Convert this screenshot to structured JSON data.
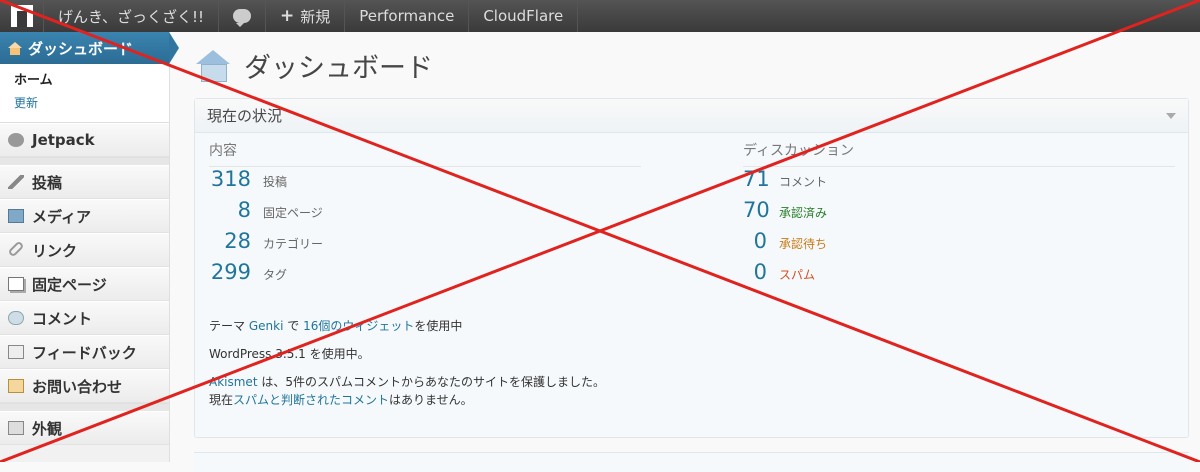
{
  "adminbar": {
    "site_name": "げんき、ざっくざく!!",
    "new_label": "新規",
    "performance": "Performance",
    "cloudflare": "CloudFlare"
  },
  "sidebar": {
    "dashboard": "ダッシュボード",
    "submenu_home": "ホーム",
    "submenu_updates": "更新",
    "items": [
      {
        "label": "Jetpack",
        "icon": "jetpack-icon"
      },
      {
        "label": "投稿",
        "icon": "pin-icon"
      },
      {
        "label": "メディア",
        "icon": "media-icon"
      },
      {
        "label": "リンク",
        "icon": "link-icon"
      },
      {
        "label": "固定ページ",
        "icon": "page-icon"
      },
      {
        "label": "コメント",
        "icon": "comment-icon"
      },
      {
        "label": "フィードバック",
        "icon": "feedback-icon"
      },
      {
        "label": "お問い合わせ",
        "icon": "contact-icon"
      },
      {
        "label": "外観",
        "icon": "appearance-icon"
      }
    ]
  },
  "main": {
    "title": "ダッシュボード",
    "right_now": {
      "heading": "現在の状況",
      "content_heading": "内容",
      "discussion_heading": "ディスカッション",
      "content": [
        {
          "num": "318",
          "label": "投稿"
        },
        {
          "num": "8",
          "label": "固定ページ"
        },
        {
          "num": "28",
          "label": "カテゴリー"
        },
        {
          "num": "299",
          "label": "タグ"
        }
      ],
      "discussion": [
        {
          "num": "71",
          "label": "コメント"
        },
        {
          "num": "70",
          "label": "承認済み"
        },
        {
          "num": "0",
          "label": "承認待ち"
        },
        {
          "num": "0",
          "label": "スパム"
        }
      ],
      "theme_prefix": "テーマ",
      "theme_name": "Genki",
      "theme_mid": "で",
      "widgets": "16個のウィジェット",
      "theme_suffix": "を使用中",
      "wp_name": "WordPress 3.5.1",
      "wp_suffix": "を使用中。",
      "akismet_name": "Akismet",
      "akismet_text": "は、5件のスパムコメントからあなたのサイトを保護しました。",
      "akismet_prefix2": "現在",
      "akismet_spam_link": "スパムと判断されたコメント",
      "akismet_suffix2": "はありません。"
    }
  },
  "colors": {
    "accent": "#21759b",
    "cross": "#e0231f"
  }
}
